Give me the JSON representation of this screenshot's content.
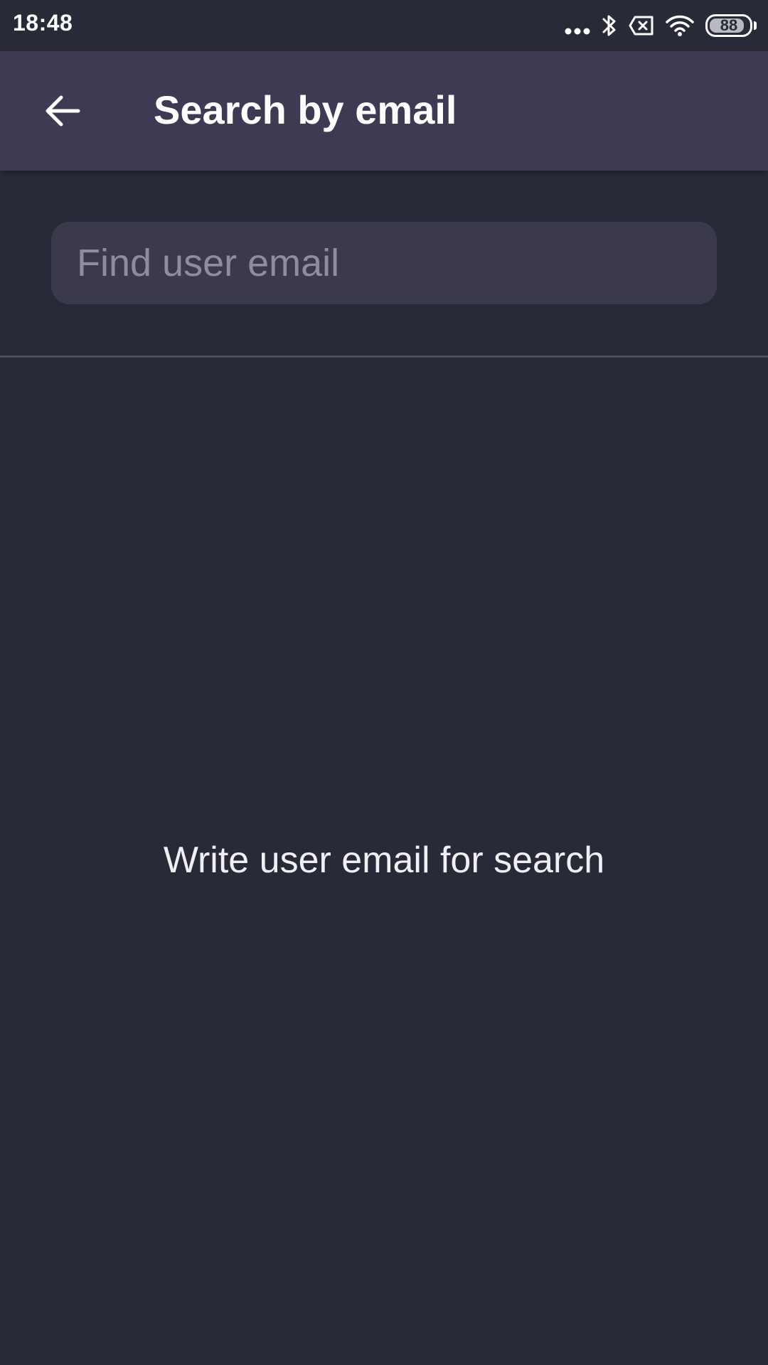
{
  "status_bar": {
    "time": "18:48",
    "battery_level": "88",
    "icons": [
      "more-dots-icon",
      "bluetooth-icon",
      "no-sim-icon",
      "wifi-icon",
      "battery-icon"
    ]
  },
  "app_bar": {
    "back_icon": "arrow-back-icon",
    "title": "Search by email"
  },
  "search": {
    "value": "",
    "placeholder": "Find user email"
  },
  "empty_state": {
    "message": "Write user email for search"
  },
  "colors": {
    "background": "#292a37",
    "app_bar": "#3e3a54",
    "input_background": "#3b3a4d",
    "placeholder": "#8e8d9c",
    "divider": "#4d4c63",
    "text": "#ffffff"
  }
}
